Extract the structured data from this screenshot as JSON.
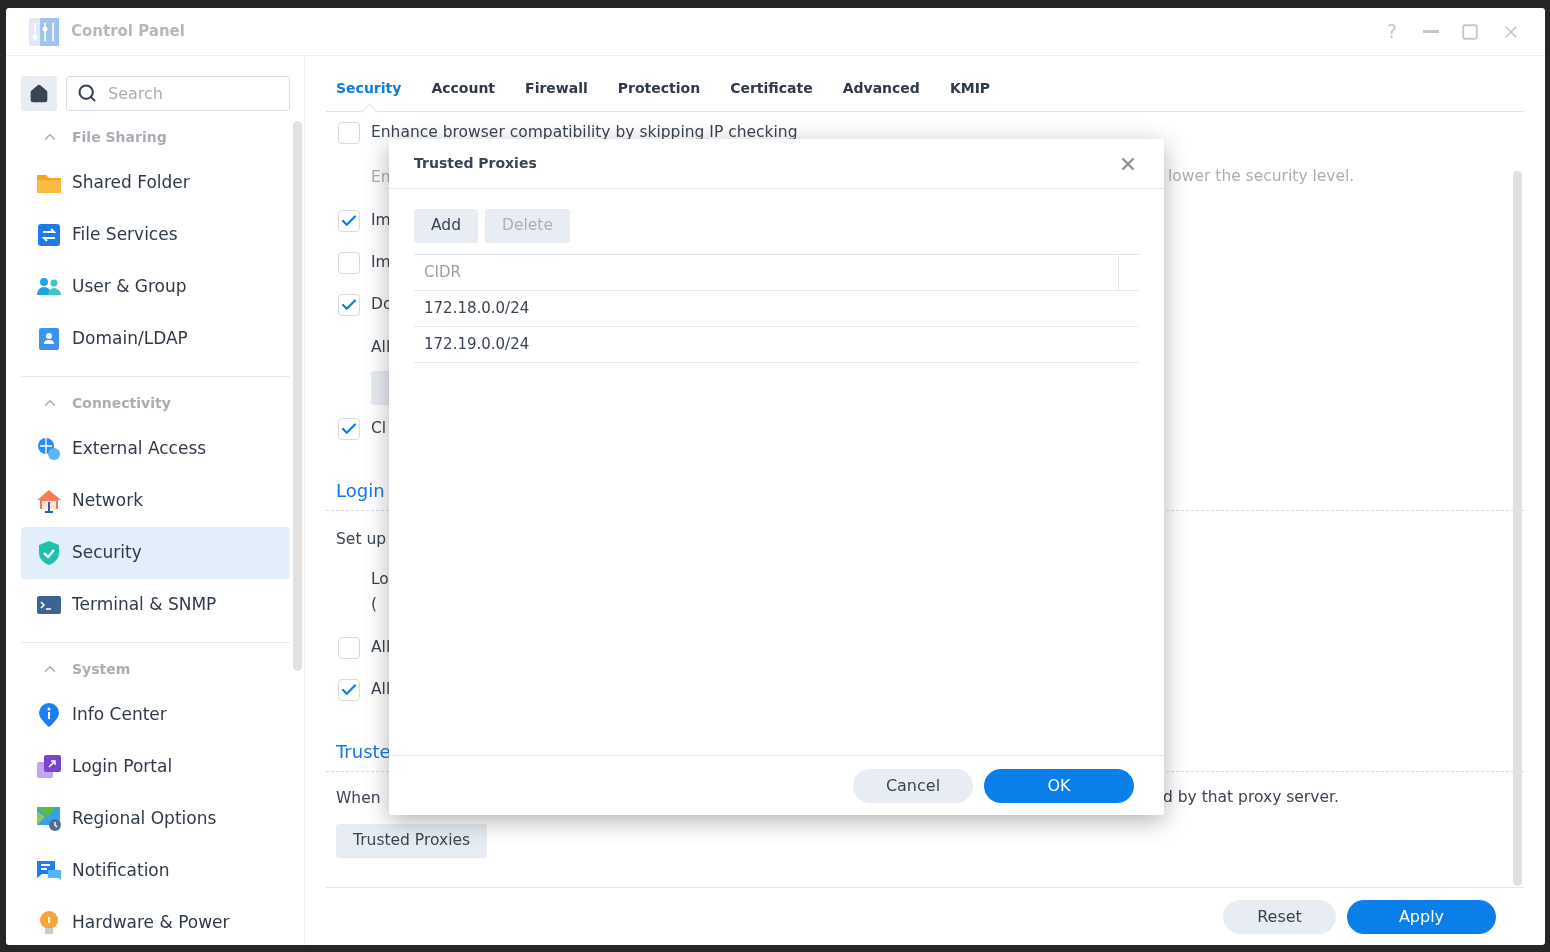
{
  "window": {
    "title": "Control Panel",
    "help": "?"
  },
  "sidebar": {
    "search": {
      "placeholder": "Search"
    },
    "groups": [
      {
        "title": "File Sharing",
        "expanded": true,
        "items": [
          {
            "label": "Shared Folder",
            "selected": false
          },
          {
            "label": "File Services",
            "selected": false
          },
          {
            "label": "User & Group",
            "selected": false
          },
          {
            "label": "Domain/LDAP",
            "selected": false
          }
        ]
      },
      {
        "title": "Connectivity",
        "expanded": true,
        "items": [
          {
            "label": "External Access",
            "selected": false
          },
          {
            "label": "Network",
            "selected": false
          },
          {
            "label": "Security",
            "selected": true
          },
          {
            "label": "Terminal & SNMP",
            "selected": false
          }
        ]
      },
      {
        "title": "System",
        "expanded": true,
        "items": [
          {
            "label": "Info Center",
            "selected": false
          },
          {
            "label": "Login Portal",
            "selected": false
          },
          {
            "label": "Regional Options",
            "selected": false
          },
          {
            "label": "Notification",
            "selected": false
          },
          {
            "label": "Hardware & Power",
            "selected": false
          }
        ]
      }
    ]
  },
  "tabs": [
    {
      "label": "Security",
      "selected": true
    },
    {
      "label": "Account",
      "selected": false
    },
    {
      "label": "Firewall",
      "selected": false
    },
    {
      "label": "Protection",
      "selected": false
    },
    {
      "label": "Certificate",
      "selected": false
    },
    {
      "label": "Advanced",
      "selected": false
    },
    {
      "label": "KMIP",
      "selected": false
    }
  ],
  "settings": [
    {
      "kind": "checkbox",
      "label": "Enhance browser compatibility by skipping IP checking",
      "checked": false
    },
    {
      "kind": "hint",
      "label": "En",
      "aside": "lower the security level."
    },
    {
      "kind": "checkbox",
      "label": "Im",
      "checked": true
    },
    {
      "kind": "checkbox",
      "label": "Im",
      "checked": false
    },
    {
      "kind": "checkbox",
      "label": "Do",
      "checked": true
    },
    {
      "kind": "option",
      "lines": [
        "All"
      ]
    },
    {
      "kind": "button"
    },
    {
      "kind": "checkbox",
      "label": "Cl",
      "checked": true
    },
    {
      "kind": "heading",
      "label": "Login"
    },
    {
      "kind": "paragraph",
      "label": "Set up"
    },
    {
      "kind": "option",
      "lines": [
        "Lo",
        "("
      ]
    },
    {
      "kind": "checkbox",
      "label": "All",
      "checked": false
    },
    {
      "kind": "checkbox",
      "label": "All",
      "checked": true
    },
    {
      "kind": "heading",
      "label": "Truste"
    },
    {
      "kind": "paragraph",
      "label": "When",
      "aside": "d by that proxy server."
    },
    {
      "kind": "button",
      "label": "Trusted Proxies"
    }
  ],
  "footer": {
    "buttons": [
      {
        "label": "Reset",
        "kind": "secondary"
      },
      {
        "label": "Apply",
        "kind": "primary"
      }
    ]
  },
  "dialog": {
    "title": "Trusted Proxies",
    "toolbar": [
      {
        "label": "Add",
        "disabled": false
      },
      {
        "label": "Delete",
        "disabled": true
      }
    ],
    "table": {
      "columns": [
        "CIDR"
      ],
      "rows": [
        [
          "172.18.0.0/24"
        ],
        [
          "172.19.0.0/24"
        ]
      ]
    },
    "buttons": [
      {
        "label": "Cancel",
        "kind": "secondary"
      },
      {
        "label": "OK",
        "kind": "primary"
      }
    ]
  }
}
